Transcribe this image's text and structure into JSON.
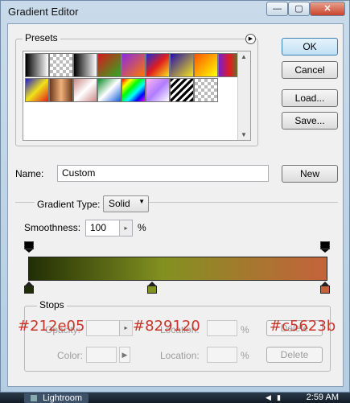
{
  "window": {
    "title": "Gradient Editor",
    "controls": {
      "minimize": "—",
      "maximize": "▢",
      "close": "✕"
    }
  },
  "presets": {
    "legend": "Presets",
    "menu_icon": "flyout-arrow-icon",
    "swatches": [
      "linear-gradient(90deg,#000,#fff)",
      "repeating-conic-gradient(#bbb 0 25%,#fff 0 50%) 0 0/8px 8px",
      "linear-gradient(90deg,#000,#fff)",
      "linear-gradient(135deg,#d61a1a,#2cab21)",
      "linear-gradient(135deg,#8a2be2,#ff7700)",
      "linear-gradient(135deg,#1b2dd6,#e11e1e,#f8e31a)",
      "linear-gradient(135deg,#2410a8,#f5e31a)",
      "linear-gradient(135deg,#f50,#ff0)",
      "linear-gradient(90deg,#7a1ec9,#e31b1b,#17a33b)",
      "linear-gradient(135deg,#1d1dd0,#f0e21a,#e11e1e)",
      "linear-gradient(90deg,#6b3a1e,#f1b07a,#6b3a1e)",
      "linear-gradient(135deg,#c88,#fff,#c88)",
      "linear-gradient(135deg,#0b8c2a,#fff,#1559d9)",
      "linear-gradient(135deg,#f00,#ff0,#0f0,#0ff,#00f,#f0f)",
      "linear-gradient(135deg,#ffb6f0,#b07cff,#fff)",
      "repeating-linear-gradient(135deg,#000 0 3px,#fff 3px 6px)",
      "repeating-conic-gradient(#bbb 0 25%,#fff 0 50%) 0 0/8px 8px"
    ]
  },
  "buttons": {
    "ok": "OK",
    "cancel": "Cancel",
    "load": "Load...",
    "save": "Save...",
    "new": "New"
  },
  "name_field": {
    "label": "Name:",
    "value": "Custom"
  },
  "gradient_type": {
    "label": "Gradient Type:",
    "value": "Solid"
  },
  "smoothness": {
    "label": "Smoothness:",
    "value": "100",
    "unit": "%"
  },
  "gradient": {
    "colors": [
      "#212e05",
      "#829120",
      "#c5623b"
    ],
    "css": "linear-gradient(90deg,#212e05 0%,#829120 45%,#c5623b 100%)"
  },
  "stops": {
    "legend": "Stops",
    "opacity_label": "Opacity:",
    "color_label": "Color:",
    "location_label": "Location:",
    "percent": "%",
    "delete_label": "Delete",
    "overlay_hex": [
      "#212e05",
      "#829120",
      "#c5623b"
    ]
  },
  "taskbar": {
    "app": "Lightroom",
    "clock": "2:59 AM"
  }
}
